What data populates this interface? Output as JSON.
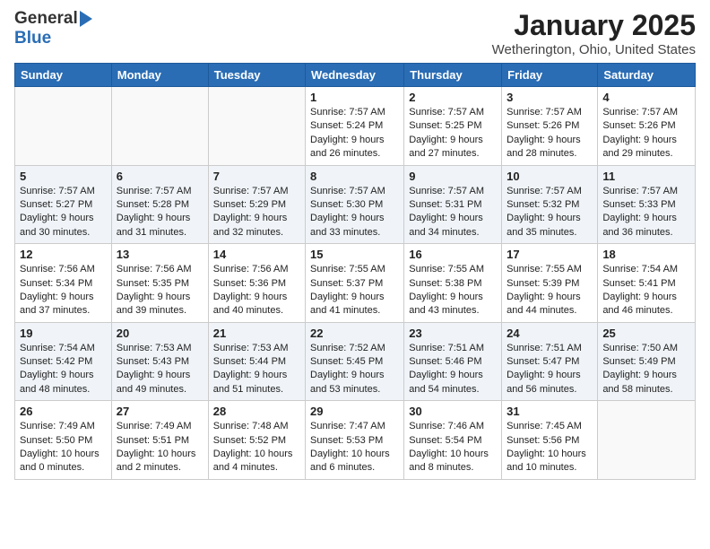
{
  "header": {
    "logo_general": "General",
    "logo_blue": "Blue",
    "title": "January 2025",
    "subtitle": "Wetherington, Ohio, United States"
  },
  "weekdays": [
    "Sunday",
    "Monday",
    "Tuesday",
    "Wednesday",
    "Thursday",
    "Friday",
    "Saturday"
  ],
  "weeks": [
    [
      {
        "day": "",
        "info": ""
      },
      {
        "day": "",
        "info": ""
      },
      {
        "day": "",
        "info": ""
      },
      {
        "day": "1",
        "info": "Sunrise: 7:57 AM\nSunset: 5:24 PM\nDaylight: 9 hours and 26 minutes."
      },
      {
        "day": "2",
        "info": "Sunrise: 7:57 AM\nSunset: 5:25 PM\nDaylight: 9 hours and 27 minutes."
      },
      {
        "day": "3",
        "info": "Sunrise: 7:57 AM\nSunset: 5:26 PM\nDaylight: 9 hours and 28 minutes."
      },
      {
        "day": "4",
        "info": "Sunrise: 7:57 AM\nSunset: 5:26 PM\nDaylight: 9 hours and 29 minutes."
      }
    ],
    [
      {
        "day": "5",
        "info": "Sunrise: 7:57 AM\nSunset: 5:27 PM\nDaylight: 9 hours and 30 minutes."
      },
      {
        "day": "6",
        "info": "Sunrise: 7:57 AM\nSunset: 5:28 PM\nDaylight: 9 hours and 31 minutes."
      },
      {
        "day": "7",
        "info": "Sunrise: 7:57 AM\nSunset: 5:29 PM\nDaylight: 9 hours and 32 minutes."
      },
      {
        "day": "8",
        "info": "Sunrise: 7:57 AM\nSunset: 5:30 PM\nDaylight: 9 hours and 33 minutes."
      },
      {
        "day": "9",
        "info": "Sunrise: 7:57 AM\nSunset: 5:31 PM\nDaylight: 9 hours and 34 minutes."
      },
      {
        "day": "10",
        "info": "Sunrise: 7:57 AM\nSunset: 5:32 PM\nDaylight: 9 hours and 35 minutes."
      },
      {
        "day": "11",
        "info": "Sunrise: 7:57 AM\nSunset: 5:33 PM\nDaylight: 9 hours and 36 minutes."
      }
    ],
    [
      {
        "day": "12",
        "info": "Sunrise: 7:56 AM\nSunset: 5:34 PM\nDaylight: 9 hours and 37 minutes."
      },
      {
        "day": "13",
        "info": "Sunrise: 7:56 AM\nSunset: 5:35 PM\nDaylight: 9 hours and 39 minutes."
      },
      {
        "day": "14",
        "info": "Sunrise: 7:56 AM\nSunset: 5:36 PM\nDaylight: 9 hours and 40 minutes."
      },
      {
        "day": "15",
        "info": "Sunrise: 7:55 AM\nSunset: 5:37 PM\nDaylight: 9 hours and 41 minutes."
      },
      {
        "day": "16",
        "info": "Sunrise: 7:55 AM\nSunset: 5:38 PM\nDaylight: 9 hours and 43 minutes."
      },
      {
        "day": "17",
        "info": "Sunrise: 7:55 AM\nSunset: 5:39 PM\nDaylight: 9 hours and 44 minutes."
      },
      {
        "day": "18",
        "info": "Sunrise: 7:54 AM\nSunset: 5:41 PM\nDaylight: 9 hours and 46 minutes."
      }
    ],
    [
      {
        "day": "19",
        "info": "Sunrise: 7:54 AM\nSunset: 5:42 PM\nDaylight: 9 hours and 48 minutes."
      },
      {
        "day": "20",
        "info": "Sunrise: 7:53 AM\nSunset: 5:43 PM\nDaylight: 9 hours and 49 minutes."
      },
      {
        "day": "21",
        "info": "Sunrise: 7:53 AM\nSunset: 5:44 PM\nDaylight: 9 hours and 51 minutes."
      },
      {
        "day": "22",
        "info": "Sunrise: 7:52 AM\nSunset: 5:45 PM\nDaylight: 9 hours and 53 minutes."
      },
      {
        "day": "23",
        "info": "Sunrise: 7:51 AM\nSunset: 5:46 PM\nDaylight: 9 hours and 54 minutes."
      },
      {
        "day": "24",
        "info": "Sunrise: 7:51 AM\nSunset: 5:47 PM\nDaylight: 9 hours and 56 minutes."
      },
      {
        "day": "25",
        "info": "Sunrise: 7:50 AM\nSunset: 5:49 PM\nDaylight: 9 hours and 58 minutes."
      }
    ],
    [
      {
        "day": "26",
        "info": "Sunrise: 7:49 AM\nSunset: 5:50 PM\nDaylight: 10 hours and 0 minutes."
      },
      {
        "day": "27",
        "info": "Sunrise: 7:49 AM\nSunset: 5:51 PM\nDaylight: 10 hours and 2 minutes."
      },
      {
        "day": "28",
        "info": "Sunrise: 7:48 AM\nSunset: 5:52 PM\nDaylight: 10 hours and 4 minutes."
      },
      {
        "day": "29",
        "info": "Sunrise: 7:47 AM\nSunset: 5:53 PM\nDaylight: 10 hours and 6 minutes."
      },
      {
        "day": "30",
        "info": "Sunrise: 7:46 AM\nSunset: 5:54 PM\nDaylight: 10 hours and 8 minutes."
      },
      {
        "day": "31",
        "info": "Sunrise: 7:45 AM\nSunset: 5:56 PM\nDaylight: 10 hours and 10 minutes."
      },
      {
        "day": "",
        "info": ""
      }
    ]
  ]
}
